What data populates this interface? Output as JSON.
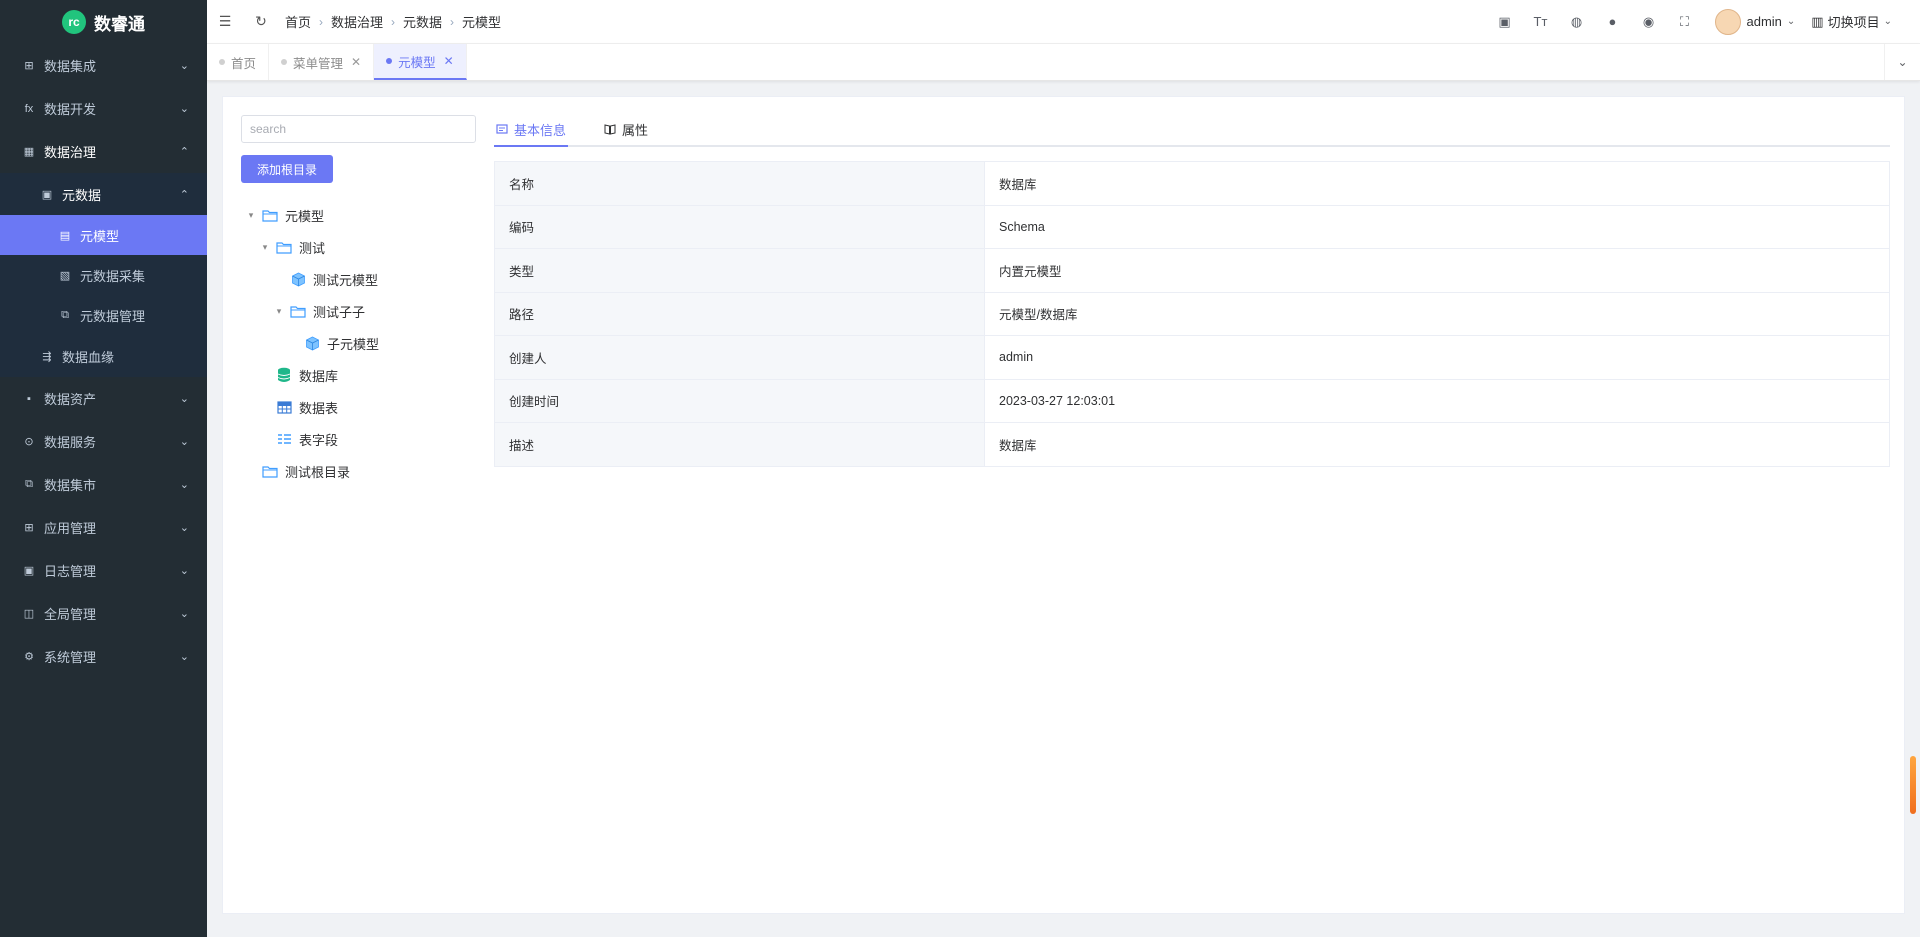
{
  "app": {
    "name": "数睿通",
    "logo_mark": "rc"
  },
  "sidebar": {
    "items": [
      {
        "label": "数据集成",
        "icon": "integration-icon",
        "glyph": "⊞",
        "arrow": "⌄",
        "level": 0
      },
      {
        "label": "数据开发",
        "icon": "function-icon",
        "glyph": "fx",
        "arrow": "⌄",
        "level": 0
      },
      {
        "label": "数据治理",
        "icon": "governance-icon",
        "glyph": "▦",
        "arrow": "⌃",
        "level": 0,
        "open": true
      },
      {
        "label": "元数据",
        "icon": "metadata-icon",
        "glyph": "▣",
        "arrow": "⌃",
        "level": 1,
        "open": true
      },
      {
        "label": "元模型",
        "icon": "document-icon",
        "glyph": "▤",
        "arrow": "",
        "level": 2,
        "active": true
      },
      {
        "label": "元数据采集",
        "icon": "collect-icon",
        "glyph": "▧",
        "arrow": "",
        "level": 2
      },
      {
        "label": "元数据管理",
        "icon": "manage-icon",
        "glyph": "⧉",
        "arrow": "",
        "level": 2
      },
      {
        "label": "数据血缘",
        "icon": "lineage-icon",
        "glyph": "⇶",
        "arrow": "",
        "level": 1
      },
      {
        "label": "数据资产",
        "icon": "asset-icon",
        "glyph": "▪",
        "arrow": "⌄",
        "level": 0
      },
      {
        "label": "数据服务",
        "icon": "service-icon",
        "glyph": "⊙",
        "arrow": "⌄",
        "level": 0
      },
      {
        "label": "数据集市",
        "icon": "market-icon",
        "glyph": "⧉",
        "arrow": "⌄",
        "level": 0
      },
      {
        "label": "应用管理",
        "icon": "app-grid-icon",
        "glyph": "⊞",
        "arrow": "⌄",
        "level": 0
      },
      {
        "label": "日志管理",
        "icon": "log-icon",
        "glyph": "▣",
        "arrow": "⌄",
        "level": 0
      },
      {
        "label": "全局管理",
        "icon": "global-icon",
        "glyph": "◫",
        "arrow": "⌄",
        "level": 0
      },
      {
        "label": "系统管理",
        "icon": "gear-icon",
        "glyph": "⚙",
        "arrow": "⌄",
        "level": 0
      }
    ]
  },
  "navbar": {
    "breadcrumb": [
      "首页",
      "数据治理",
      "元数据",
      "元模型"
    ],
    "user": "admin",
    "project": "切换项目"
  },
  "tags": [
    {
      "label": "首页",
      "closable": false,
      "active": false
    },
    {
      "label": "菜单管理",
      "closable": true,
      "active": false
    },
    {
      "label": "元模型",
      "closable": true,
      "active": true
    }
  ],
  "left_panel": {
    "search_placeholder": "search",
    "add_root_label": "添加根目录",
    "tree": [
      {
        "label": "元模型",
        "type": "folder",
        "depth": 0,
        "expanded": true
      },
      {
        "label": "测试",
        "type": "folder",
        "depth": 1,
        "expanded": true
      },
      {
        "label": "测试元模型",
        "type": "model",
        "depth": 2
      },
      {
        "label": "测试子子",
        "type": "folder",
        "depth": 2,
        "expanded": true
      },
      {
        "label": "子元模型",
        "type": "model",
        "depth": 3
      },
      {
        "label": "数据库",
        "type": "database",
        "depth": 1
      },
      {
        "label": "数据表",
        "type": "table",
        "depth": 1
      },
      {
        "label": "表字段",
        "type": "field",
        "depth": 1
      },
      {
        "label": "测试根目录",
        "type": "folder",
        "depth": 0
      }
    ]
  },
  "tabs": [
    {
      "label": "基本信息",
      "icon": "info-card-icon",
      "active": true
    },
    {
      "label": "属性",
      "icon": "book-icon",
      "active": false
    }
  ],
  "detail": [
    {
      "key": "名称",
      "value": "数据库"
    },
    {
      "key": "编码",
      "value": "Schema"
    },
    {
      "key": "类型",
      "value": "内置元模型"
    },
    {
      "key": "路径",
      "value": "元模型/数据库"
    },
    {
      "key": "创建人",
      "value": "admin"
    },
    {
      "key": "创建时间",
      "value": "2023-03-27 12:03:01"
    },
    {
      "key": "描述",
      "value": "数据库"
    }
  ],
  "colors": {
    "accent": "#6b78f4",
    "sidebar_bg": "#232d34",
    "tree_icon": "#409eff",
    "db_icon": "#1fb78a"
  }
}
